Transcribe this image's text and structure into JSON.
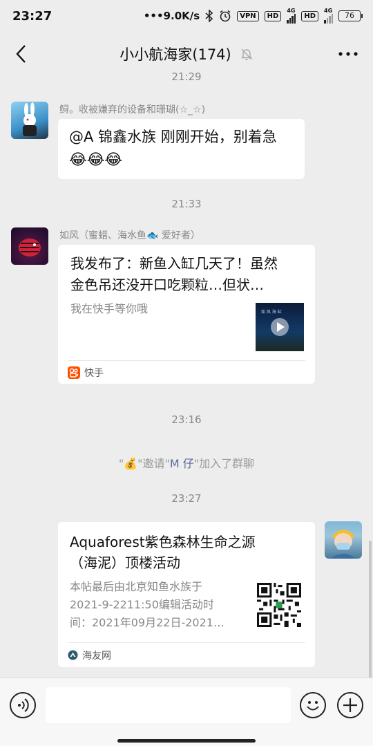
{
  "status_bar": {
    "time": "23:27",
    "speed": "•••9.0K/s",
    "vpn": "VPN",
    "hd1": "HD",
    "net1": "4G",
    "hd2": "HD",
    "net2": "4G",
    "battery": "76"
  },
  "header": {
    "title": "小小航海家(174)"
  },
  "messages": {
    "ts0": "21:29",
    "m1": {
      "sender": "鲟。收被嫌弃的设备和珊瑚(☆_☆)",
      "line1": "@A 锦鑫水族  刚刚开始，别着急",
      "emoji": "😂😂😂"
    },
    "ts1": "21:33",
    "m2": {
      "sender": "如风（蜜蜡、海水鱼🐟 爱好者）",
      "title_line1": "我发布了：新鱼入缸几天了！虽然",
      "title_line2": "金色吊还没开口吃颗粒…但状…",
      "desc": "我在快手等你哦",
      "thumb_text": "如 风 海 缸",
      "source": "快手"
    },
    "ts2": "23:16",
    "sys": {
      "q1": "\"",
      "emoji": "💰",
      "q2": "\"邀请\"",
      "name": "M 仔",
      "q3": "\"加入了群聊"
    },
    "ts3": "23:27",
    "m3": {
      "title_line1": "Aquaforest紫色森林生命之源",
      "title_line2": "（海泥）顶楼活动",
      "desc_line1": "本帖最后由北京知鱼水族于",
      "desc_line2": "2021-9-2211:50编辑活动时",
      "desc_line3": "间：2021年09月22日-2021…",
      "source": "海友网"
    }
  }
}
